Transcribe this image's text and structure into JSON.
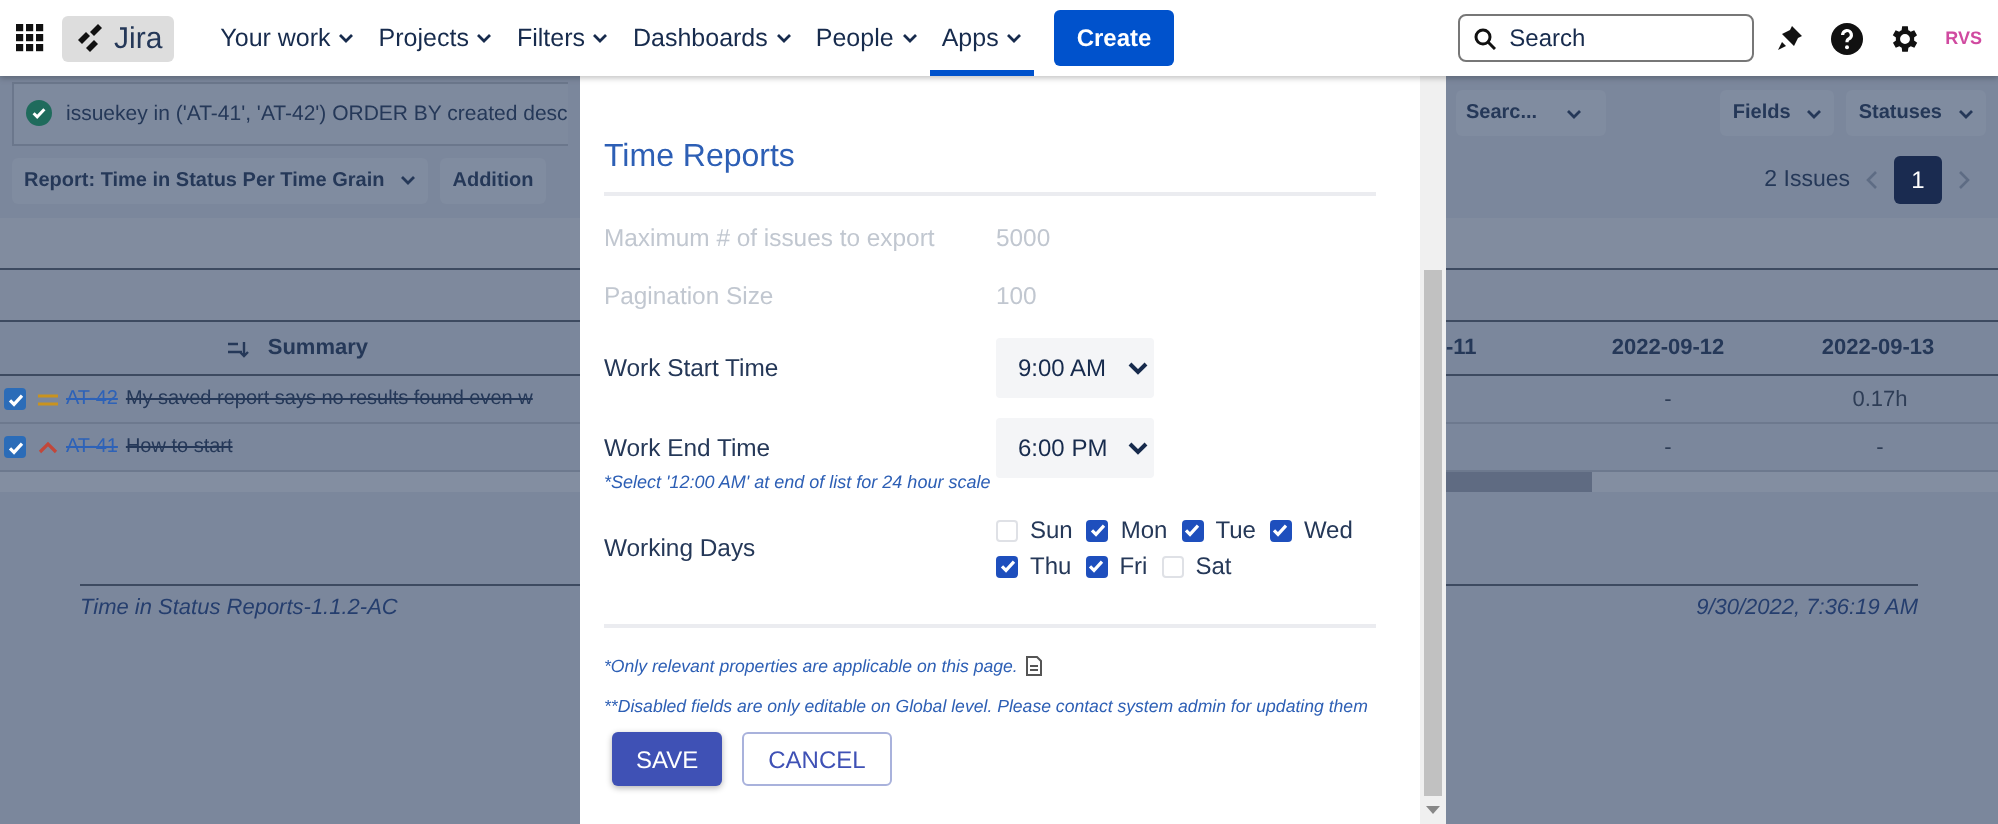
{
  "nav": {
    "logo": "Jira",
    "menu": [
      {
        "label": "Your work",
        "selected": false
      },
      {
        "label": "Projects",
        "selected": false
      },
      {
        "label": "Filters",
        "selected": false
      },
      {
        "label": "Dashboards",
        "selected": false
      },
      {
        "label": "People",
        "selected": false
      },
      {
        "label": "Apps",
        "selected": true
      }
    ],
    "create": "Create",
    "search": {
      "placeholder": "Search"
    },
    "avatar": "RVS"
  },
  "toolbar": {
    "jql": "issuekey in ('AT-41', 'AT-42') ORDER BY created desc",
    "report_button": "Report: Time in Status Per Time Grain",
    "additional_button": "Addition",
    "search_button": "Searc...",
    "fields_button": "Fields",
    "statuses_button": "Statuses",
    "issue_count": "2 Issues",
    "pages": [
      {
        "label": "1",
        "selected": true
      }
    ]
  },
  "table": {
    "summary_header": "Summary",
    "date_headers": [
      "-11",
      "2022-09-12",
      "2022-09-13"
    ],
    "rows": [
      {
        "checked": true,
        "kind": "medium",
        "resolved": true,
        "key": "AT-42",
        "summary": "My saved report says no results found even w",
        "cells": [
          "-",
          "0.17h"
        ]
      },
      {
        "checked": true,
        "kind": "high",
        "resolved": true,
        "key": "AT-41",
        "summary": "How to start",
        "cells": [
          "-",
          "-"
        ]
      }
    ]
  },
  "footer": {
    "version": "Time in Status Reports-1.1.2-AC",
    "timestamp": "9/30/2022, 7:36:19 AM"
  },
  "dialog": {
    "title": "Time Reports",
    "fields": [
      {
        "kind": "text",
        "label": "Maximum # of issues to export",
        "value": "5000",
        "disabled": true
      },
      {
        "kind": "text",
        "label": "Pagination Size",
        "value": "100",
        "disabled": true
      },
      {
        "kind": "select",
        "label": "Work Start Time",
        "value": "9:00 AM",
        "disabled": false
      },
      {
        "kind": "select",
        "label": "Work End Time",
        "value": "6:00 PM",
        "disabled": false,
        "hint": "*Select '12:00 AM' at end of list for 24 hour scale"
      },
      {
        "kind": "days",
        "label": "Working Days",
        "disabled": false,
        "days": [
          {
            "label": "Sun",
            "checked": false
          },
          {
            "label": "Mon",
            "checked": true
          },
          {
            "label": "Tue",
            "checked": true
          },
          {
            "label": "Wed",
            "checked": true
          },
          {
            "label": "Thu",
            "checked": true
          },
          {
            "label": "Fri",
            "checked": true
          },
          {
            "label": "Sat",
            "checked": false
          }
        ]
      }
    ],
    "notes": [
      "*Only relevant properties are applicable on this page.",
      "**Disabled fields are only editable on Global level. Please contact system admin for updating them"
    ],
    "buttons": [
      {
        "label": "SAVE",
        "kind": "primary"
      },
      {
        "label": "CANCEL",
        "kind": "secondary"
      }
    ]
  }
}
